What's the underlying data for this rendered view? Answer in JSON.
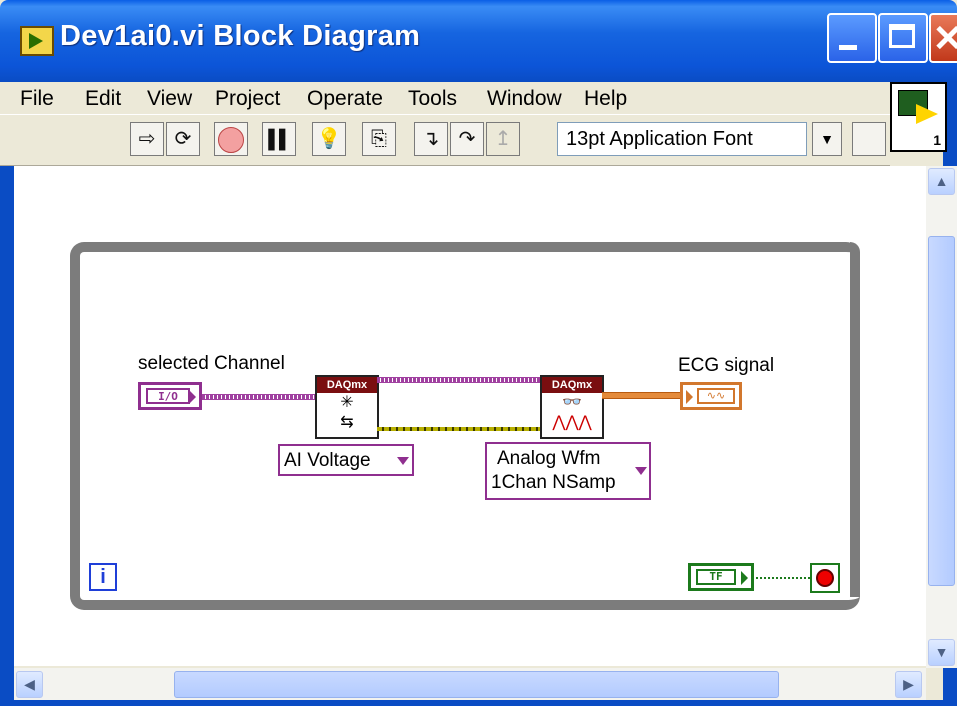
{
  "window": {
    "title": "Dev1ai0.vi Block Diagram"
  },
  "menu": [
    "File",
    "Edit",
    "View",
    "Project",
    "Operate",
    "Tools",
    "Window",
    "Help"
  ],
  "toolbar": {
    "font": "13pt Application Font",
    "buttons": [
      "run-arrow-icon",
      "run-continuously-icon",
      "abort-icon",
      "pause-icon",
      "highlight-execution-icon",
      "retain-wire-values-icon",
      "step-into-icon",
      "step-over-icon",
      "step-out-icon",
      "align-objects-icon"
    ]
  },
  "connector_pane": {
    "number": "1"
  },
  "diagram": {
    "channel_label": "selected Channel",
    "channel_terminal_text": "I/O",
    "create_channel_node": {
      "header": "DAQmx"
    },
    "ai_voltage": "AI Voltage",
    "read_node": {
      "header": "DAQmx"
    },
    "read_mode_line1": "Analog Wfm",
    "read_mode_line2": "1Chan NSamp",
    "ecg_label": "ECG signal",
    "bool_const_text": "TF",
    "iteration_terminal": "i"
  },
  "colors": {
    "titlebar": "#0a5fe6",
    "refnum_wire": "#a040a0",
    "waveform_wire": "#e48a3a",
    "boolean": "#1c7a1c",
    "while_loop": "#7c7c7c"
  }
}
